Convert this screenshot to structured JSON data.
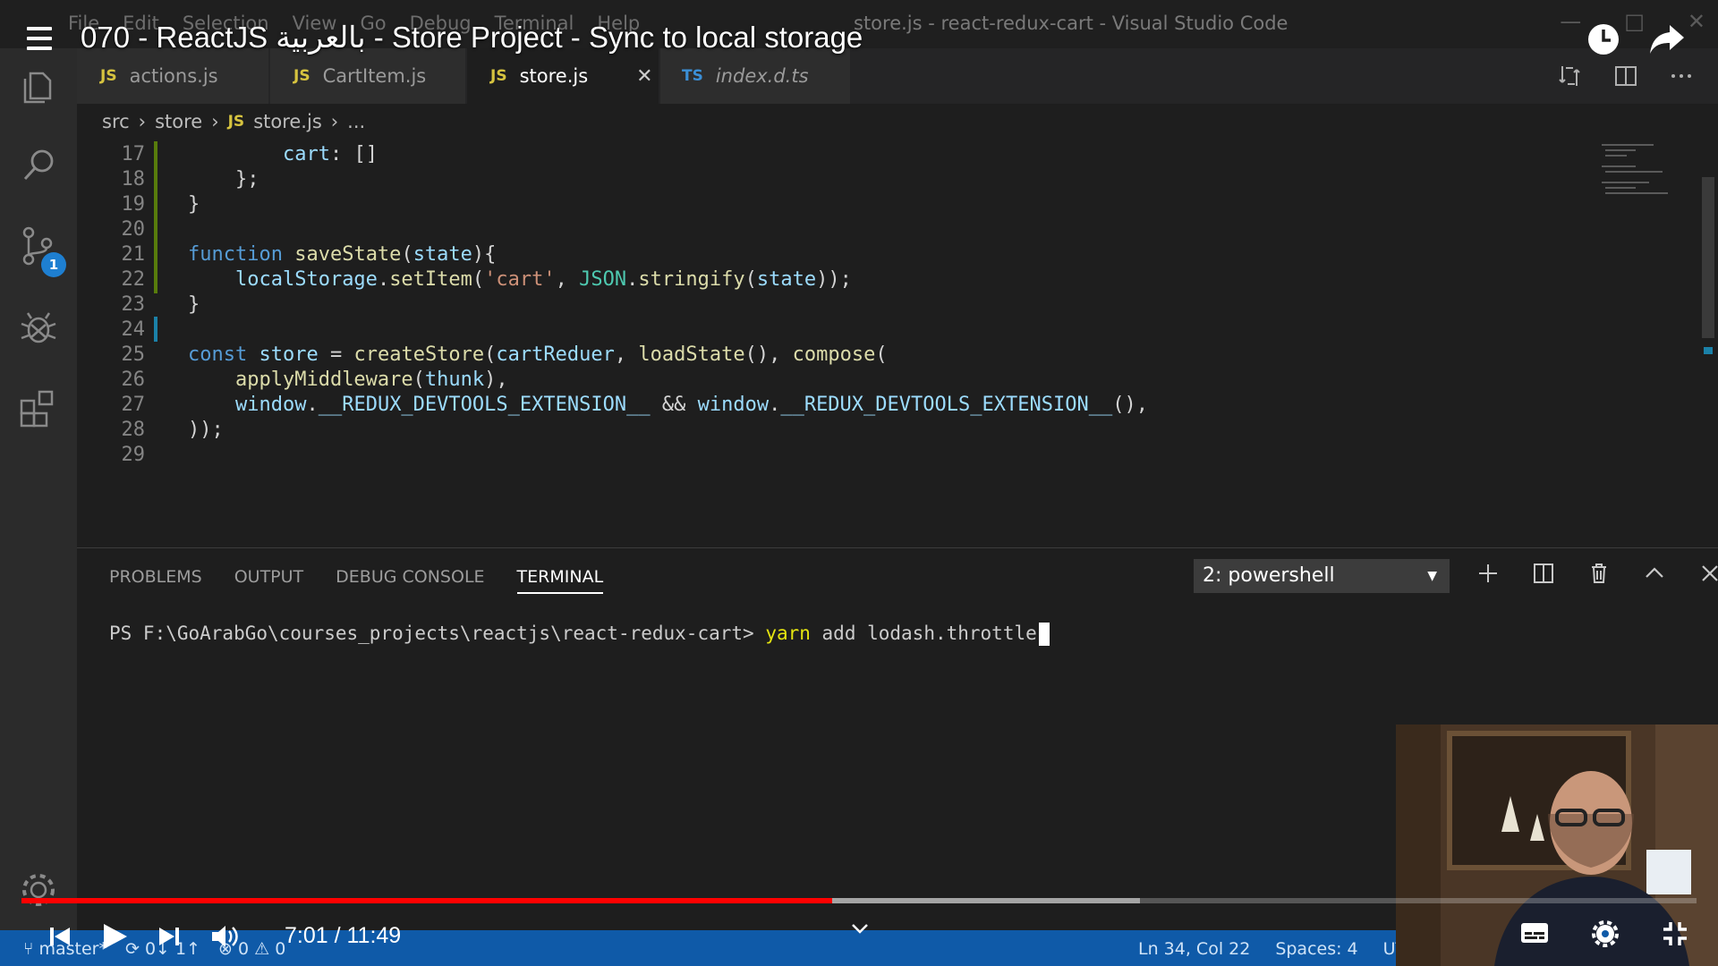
{
  "titlebar": {
    "menu": [
      "File",
      "Edit",
      "Selection",
      "View",
      "Go",
      "Debug",
      "Terminal",
      "Help"
    ],
    "window_title": "store.js - react-redux-cart - Visual Studio Code"
  },
  "video": {
    "title": "070 - ReactJS بالعربية - Store Project - Sync to local storage",
    "time": "7:01 / 11:49",
    "progress_fraction": 0.484,
    "buffer_fraction": 0.668
  },
  "activity": {
    "scm_badge": "1",
    "icons": [
      "explorer-icon",
      "search-icon",
      "source-control-icon",
      "debug-icon",
      "extensions-icon",
      "settings-gear-icon"
    ]
  },
  "tabs": [
    {
      "kind": "JS",
      "label": "actions.js"
    },
    {
      "kind": "JS",
      "label": "CartItem.js"
    },
    {
      "kind": "JS",
      "label": "store.js",
      "active": true
    },
    {
      "kind": "TS",
      "label": "index.d.ts"
    }
  ],
  "breadcrumb": {
    "parts": [
      "src",
      "store"
    ],
    "file_kind": "JS",
    "file": "store.js",
    "more": "..."
  },
  "code": {
    "lines": [
      {
        "n": "17",
        "text": "        cart: []"
      },
      {
        "n": "18",
        "text": "    };"
      },
      {
        "n": "19",
        "text": "}"
      },
      {
        "n": "20",
        "text": ""
      },
      {
        "n": "21",
        "text": "function saveState(state){"
      },
      {
        "n": "22",
        "text": "    localStorage.setItem('cart', JSON.stringify(state));"
      },
      {
        "n": "23",
        "text": "}"
      },
      {
        "n": "24",
        "text": ""
      },
      {
        "n": "25",
        "text": "const store = createStore(cartReduer, loadState(), compose("
      },
      {
        "n": "26",
        "text": "    applyMiddleware(thunk),"
      },
      {
        "n": "27",
        "text": "    window.__REDUX_DEVTOOLS_EXTENSION__ && window.__REDUX_DEVTOOLS_EXTENSION__(),"
      },
      {
        "n": "28",
        "text": "));"
      },
      {
        "n": "29",
        "text": ""
      }
    ]
  },
  "panel": {
    "tabs": [
      "PROBLEMS",
      "OUTPUT",
      "DEBUG CONSOLE",
      "TERMINAL"
    ],
    "active_tab": "TERMINAL",
    "terminal_select": "2: powershell",
    "prompt": "PS F:\\GoArabGo\\courses_projects\\reactjs\\react-redux-cart> ",
    "command_keyword": "yarn",
    "command_rest": " add lodash.throttle"
  },
  "status": {
    "branch": "master*",
    "sync": "0↓ 1↑",
    "errors": "0",
    "warnings": "0",
    "position": "Ln 34, Col 22",
    "spaces": "Spaces: 4",
    "encoding": "UT"
  },
  "colors": {
    "status_bar": "#0f5aa8",
    "progress_played": "#ff0000",
    "keyword": "#569cd6",
    "function": "#dcdcaa",
    "string": "#ce9178"
  }
}
